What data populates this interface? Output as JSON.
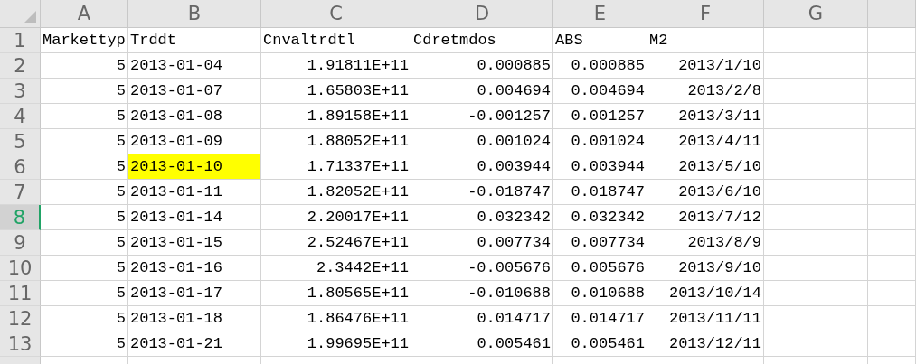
{
  "columns": [
    "A",
    "B",
    "C",
    "D",
    "E",
    "F",
    "G"
  ],
  "rows": [
    {
      "number": "1",
      "selected": false,
      "cells": [
        {
          "text": "Markettyp",
          "kind": "text",
          "highlighted": false
        },
        {
          "text": "Trddt",
          "kind": "text",
          "highlighted": false
        },
        {
          "text": "Cnvaltrdtl",
          "kind": "text",
          "highlighted": false
        },
        {
          "text": "Cdretmdos",
          "kind": "text",
          "highlighted": false
        },
        {
          "text": "ABS",
          "kind": "text",
          "highlighted": false
        },
        {
          "text": "M2",
          "kind": "text",
          "highlighted": false
        }
      ]
    },
    {
      "number": "2",
      "selected": false,
      "cells": [
        {
          "text": "5",
          "kind": "number",
          "highlighted": false
        },
        {
          "text": "2013-01-04",
          "kind": "text",
          "highlighted": false
        },
        {
          "text": "1.91811E+11",
          "kind": "number",
          "highlighted": false
        },
        {
          "text": "0.000885",
          "kind": "number",
          "highlighted": false
        },
        {
          "text": "0.000885",
          "kind": "number",
          "highlighted": false
        },
        {
          "text": "2013/1/10",
          "kind": "number",
          "highlighted": false
        }
      ]
    },
    {
      "number": "3",
      "selected": false,
      "cells": [
        {
          "text": "5",
          "kind": "number",
          "highlighted": false
        },
        {
          "text": "2013-01-07",
          "kind": "text",
          "highlighted": false
        },
        {
          "text": "1.65803E+11",
          "kind": "number",
          "highlighted": false
        },
        {
          "text": "0.004694",
          "kind": "number",
          "highlighted": false
        },
        {
          "text": "0.004694",
          "kind": "number",
          "highlighted": false
        },
        {
          "text": "2013/2/8",
          "kind": "number",
          "highlighted": false
        }
      ]
    },
    {
      "number": "4",
      "selected": false,
      "cells": [
        {
          "text": "5",
          "kind": "number",
          "highlighted": false
        },
        {
          "text": "2013-01-08",
          "kind": "text",
          "highlighted": false
        },
        {
          "text": "1.89158E+11",
          "kind": "number",
          "highlighted": false
        },
        {
          "text": "-0.001257",
          "kind": "number",
          "highlighted": false
        },
        {
          "text": "0.001257",
          "kind": "number",
          "highlighted": false
        },
        {
          "text": "2013/3/11",
          "kind": "number",
          "highlighted": false
        }
      ]
    },
    {
      "number": "5",
      "selected": false,
      "cells": [
        {
          "text": "5",
          "kind": "number",
          "highlighted": false
        },
        {
          "text": "2013-01-09",
          "kind": "text",
          "highlighted": false
        },
        {
          "text": "1.88052E+11",
          "kind": "number",
          "highlighted": false
        },
        {
          "text": "0.001024",
          "kind": "number",
          "highlighted": false
        },
        {
          "text": "0.001024",
          "kind": "number",
          "highlighted": false
        },
        {
          "text": "2013/4/11",
          "kind": "number",
          "highlighted": false
        }
      ]
    },
    {
      "number": "6",
      "selected": false,
      "cells": [
        {
          "text": "5",
          "kind": "number",
          "highlighted": false
        },
        {
          "text": "2013-01-10",
          "kind": "text",
          "highlighted": true
        },
        {
          "text": "1.71337E+11",
          "kind": "number",
          "highlighted": false
        },
        {
          "text": "0.003944",
          "kind": "number",
          "highlighted": false
        },
        {
          "text": "0.003944",
          "kind": "number",
          "highlighted": false
        },
        {
          "text": "2013/5/10",
          "kind": "number",
          "highlighted": false
        }
      ]
    },
    {
      "number": "7",
      "selected": false,
      "cells": [
        {
          "text": "5",
          "kind": "number",
          "highlighted": false
        },
        {
          "text": "2013-01-11",
          "kind": "text",
          "highlighted": false
        },
        {
          "text": "1.82052E+11",
          "kind": "number",
          "highlighted": false
        },
        {
          "text": "-0.018747",
          "kind": "number",
          "highlighted": false
        },
        {
          "text": "0.018747",
          "kind": "number",
          "highlighted": false
        },
        {
          "text": "2013/6/10",
          "kind": "number",
          "highlighted": false
        }
      ]
    },
    {
      "number": "8",
      "selected": true,
      "cells": [
        {
          "text": "5",
          "kind": "number",
          "highlighted": false
        },
        {
          "text": "2013-01-14",
          "kind": "text",
          "highlighted": false
        },
        {
          "text": "2.20017E+11",
          "kind": "number",
          "highlighted": false
        },
        {
          "text": "0.032342",
          "kind": "number",
          "highlighted": false
        },
        {
          "text": "0.032342",
          "kind": "number",
          "highlighted": false
        },
        {
          "text": "2013/7/12",
          "kind": "number",
          "highlighted": false
        }
      ]
    },
    {
      "number": "9",
      "selected": false,
      "cells": [
        {
          "text": "5",
          "kind": "number",
          "highlighted": false
        },
        {
          "text": "2013-01-15",
          "kind": "text",
          "highlighted": false
        },
        {
          "text": "2.52467E+11",
          "kind": "number",
          "highlighted": false
        },
        {
          "text": "0.007734",
          "kind": "number",
          "highlighted": false
        },
        {
          "text": "0.007734",
          "kind": "number",
          "highlighted": false
        },
        {
          "text": "2013/8/9",
          "kind": "number",
          "highlighted": false
        }
      ]
    },
    {
      "number": "10",
      "selected": false,
      "cells": [
        {
          "text": "5",
          "kind": "number",
          "highlighted": false
        },
        {
          "text": "2013-01-16",
          "kind": "text",
          "highlighted": false
        },
        {
          "text": "2.3442E+11",
          "kind": "number",
          "highlighted": false
        },
        {
          "text": "-0.005676",
          "kind": "number",
          "highlighted": false
        },
        {
          "text": "0.005676",
          "kind": "number",
          "highlighted": false
        },
        {
          "text": "2013/9/10",
          "kind": "number",
          "highlighted": false
        }
      ]
    },
    {
      "number": "11",
      "selected": false,
      "cells": [
        {
          "text": "5",
          "kind": "number",
          "highlighted": false
        },
        {
          "text": "2013-01-17",
          "kind": "text",
          "highlighted": false
        },
        {
          "text": "1.80565E+11",
          "kind": "number",
          "highlighted": false
        },
        {
          "text": "-0.010688",
          "kind": "number",
          "highlighted": false
        },
        {
          "text": "0.010688",
          "kind": "number",
          "highlighted": false
        },
        {
          "text": "2013/10/14",
          "kind": "number",
          "highlighted": false
        }
      ]
    },
    {
      "number": "12",
      "selected": false,
      "cells": [
        {
          "text": "5",
          "kind": "number",
          "highlighted": false
        },
        {
          "text": "2013-01-18",
          "kind": "text",
          "highlighted": false
        },
        {
          "text": "1.86476E+11",
          "kind": "number",
          "highlighted": false
        },
        {
          "text": "0.014717",
          "kind": "number",
          "highlighted": false
        },
        {
          "text": "0.014717",
          "kind": "number",
          "highlighted": false
        },
        {
          "text": "2013/11/11",
          "kind": "number",
          "highlighted": false
        }
      ]
    },
    {
      "number": "13",
      "selected": false,
      "cells": [
        {
          "text": "5",
          "kind": "number",
          "highlighted": false
        },
        {
          "text": "2013-01-21",
          "kind": "text",
          "highlighted": false
        },
        {
          "text": "1.99695E+11",
          "kind": "number",
          "highlighted": false
        },
        {
          "text": "0.005461",
          "kind": "number",
          "highlighted": false
        },
        {
          "text": "0.005461",
          "kind": "number",
          "highlighted": false
        },
        {
          "text": "2013/12/11",
          "kind": "number",
          "highlighted": false
        }
      ]
    }
  ]
}
